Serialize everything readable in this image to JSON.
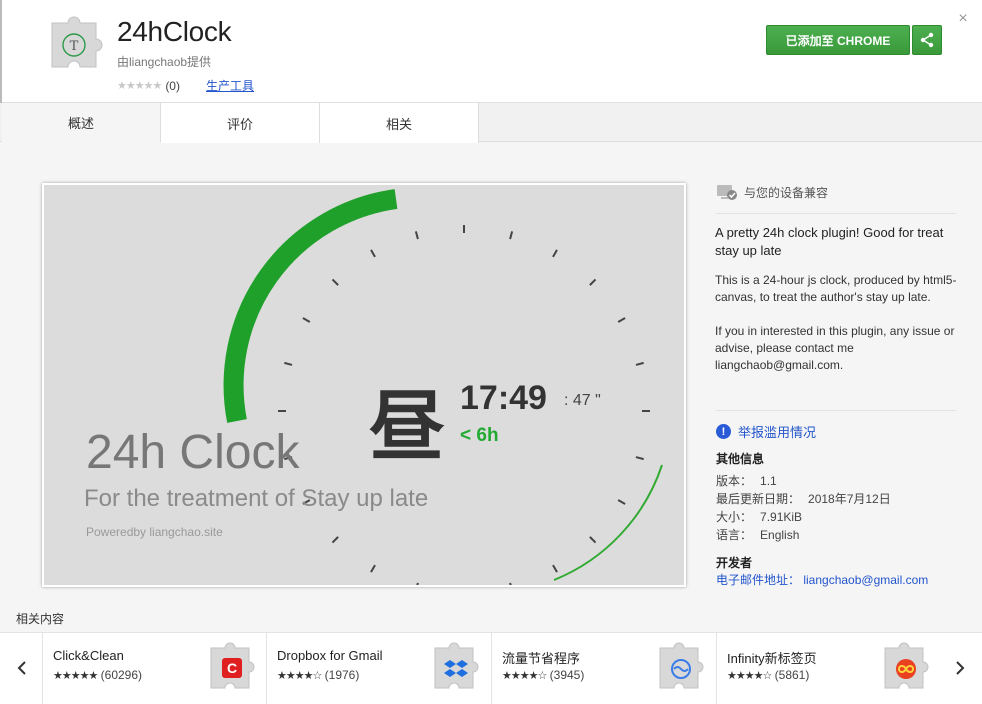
{
  "extension": {
    "title": "24hClock",
    "author": "由liangchaob提供",
    "rating_count": "(0)",
    "category": "生产工具"
  },
  "actions": {
    "add_label": "已添加至 CHROME",
    "close_glyph": "×"
  },
  "tabs": [
    {
      "label": "概述",
      "active": true
    },
    {
      "label": "评价",
      "active": false
    },
    {
      "label": "相关",
      "active": false
    }
  ],
  "screenshot": {
    "zhou": "昼",
    "time": "17:49",
    "seconds": ": 47 \"",
    "delta": "< 6h",
    "name": "24h Clock",
    "subtitle": "For the treatment of Stay up late",
    "powered": "Poweredby liangchao.site"
  },
  "sidebar": {
    "compat": "与您的设备兼容",
    "summary": "A pretty 24h clock plugin! Good for treat stay up late",
    "description": "This is a 24-hour js clock, produced by html5-canvas, to treat the author's stay up late.\n\nIf you in interested in this plugin, any issue or advise,  please contact me liangchaob@gmail.com.",
    "report": "举报滥用情况",
    "meta_heading": "其他信息",
    "meta": [
      {
        "label": "版本：",
        "value": "1.1"
      },
      {
        "label": "最后更新日期：",
        "value": "2018年7月12日"
      },
      {
        "label": "大小：",
        "value": "7.91KiB"
      },
      {
        "label": "语言：",
        "value": "English"
      }
    ],
    "developer_heading": "开发者",
    "developer_email": "电子邮件地址：  liangchaob@gmail.com"
  },
  "related": {
    "title": "相关内容",
    "items": [
      {
        "name": "Click&Clean",
        "stars": "★★★★★",
        "count": "(60296)",
        "icon": "click-clean-icon",
        "color": "#e02020"
      },
      {
        "name": "Dropbox for Gmail",
        "stars": "★★★★☆",
        "count": "(1976)",
        "icon": "dropbox-icon",
        "color": "#1f6fe0"
      },
      {
        "name": "流量节省程序",
        "stars": "★★★★☆",
        "count": "(3945)",
        "icon": "data-saver-icon",
        "color": "#3b7de8"
      },
      {
        "name": "Infinity新标签页",
        "stars": "★★★★☆",
        "count": "(5861)",
        "icon": "infinity-icon",
        "color": "#e84020"
      }
    ]
  },
  "colors": {
    "accent_green": "#3a9a3a",
    "link_blue": "#2255cc"
  }
}
